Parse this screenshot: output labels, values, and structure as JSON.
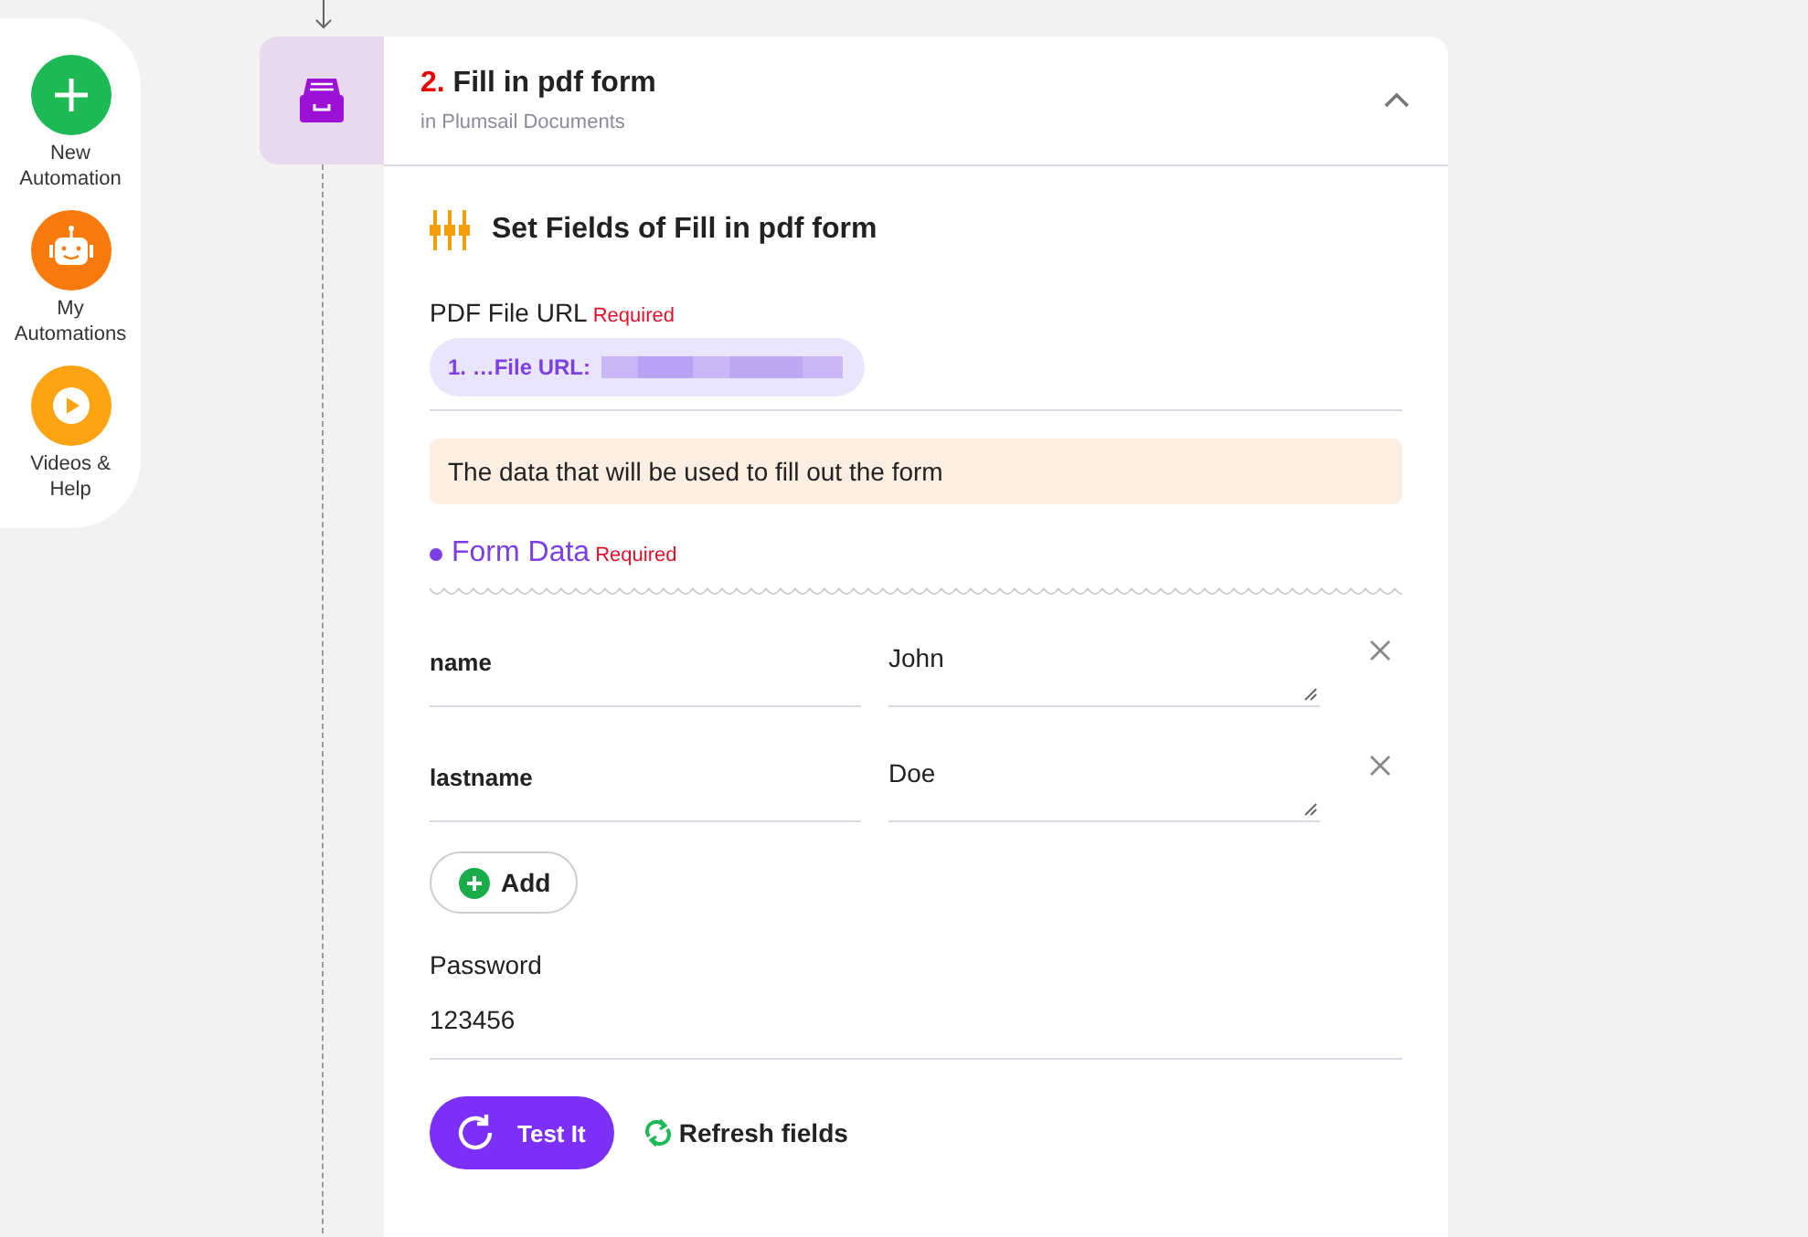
{
  "sidebar": {
    "items": [
      {
        "label": "New Automation",
        "kind": "new"
      },
      {
        "label": "My Automations",
        "kind": "robot"
      },
      {
        "label": "Videos & Help",
        "kind": "play"
      }
    ]
  },
  "step": {
    "number": "2.",
    "title": "Fill in pdf form",
    "subtitle": "in Plumsail Documents",
    "expanded": true
  },
  "section": {
    "title": "Set Fields of Fill in pdf form"
  },
  "pdf_url": {
    "label": "PDF File URL",
    "required": "Required",
    "token": "1. …File URL:"
  },
  "hint": "The data that will be used to fill out the form",
  "form_data": {
    "label": "Form Data",
    "required": "Required",
    "rows": [
      {
        "key": "name",
        "value": "John"
      },
      {
        "key": "lastname",
        "value": "Doe"
      }
    ],
    "add": "Add"
  },
  "password": {
    "label": "Password",
    "value": "123456"
  },
  "buttons": {
    "test": "Test It",
    "refresh": "Refresh fields"
  }
}
